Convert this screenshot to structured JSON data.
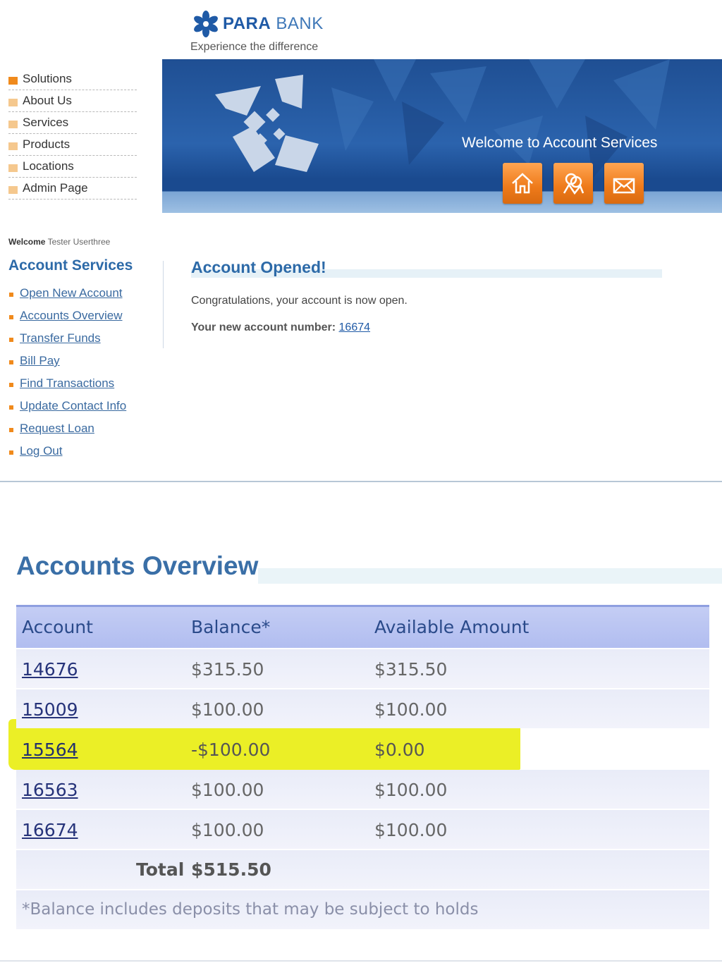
{
  "brand": {
    "name_part1": "PARA",
    "name_part2": "BANK",
    "tagline": "Experience the difference"
  },
  "top_menu": [
    {
      "label": "Solutions",
      "active": true
    },
    {
      "label": "About Us"
    },
    {
      "label": "Services"
    },
    {
      "label": "Products"
    },
    {
      "label": "Locations"
    },
    {
      "label": "Admin Page"
    }
  ],
  "banner": {
    "title": "Welcome to Account Services",
    "icons": [
      "home-icon",
      "contact-icon",
      "email-icon"
    ]
  },
  "sidebar": {
    "welcome_label": "Welcome",
    "user_name": "Tester Userthree",
    "title": "Account Services",
    "links": [
      "Open New Account",
      "Accounts Overview",
      "Transfer Funds",
      "Bill Pay",
      "Find Transactions",
      "Update Contact Info",
      "Request Loan",
      "Log Out"
    ]
  },
  "main": {
    "title": "Account Opened!",
    "congrats": "Congratulations, your account is now open.",
    "new_account_label": "Your new account number:",
    "new_account_number": "16674"
  },
  "overview": {
    "title": "Accounts Overview",
    "headers": [
      "Account",
      "Balance*",
      "Available Amount"
    ],
    "rows": [
      {
        "account": "14676",
        "balance": "$315.50",
        "available": "$315.50"
      },
      {
        "account": "15009",
        "balance": "$100.00",
        "available": "$100.00"
      },
      {
        "account": "15564",
        "balance": "-$100.00",
        "available": "$0.00",
        "highlighted": true
      },
      {
        "account": "16563",
        "balance": "$100.00",
        "available": "$100.00"
      },
      {
        "account": "16674",
        "balance": "$100.00",
        "available": "$100.00"
      }
    ],
    "total_label": "Total",
    "total_value": "$515.50",
    "note": "*Balance includes deposits that may be subject to holds"
  },
  "colors": {
    "brand_blue": "#1f5aa6",
    "accent_orange": "#f08a1c",
    "highlight_yellow": "#e8ec00",
    "table_header": "#b1bdf0"
  }
}
